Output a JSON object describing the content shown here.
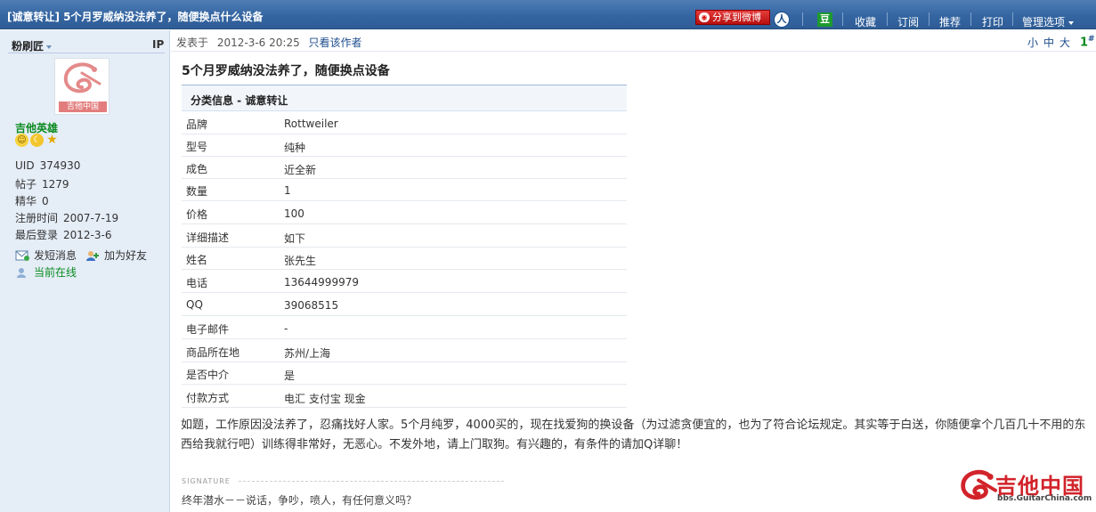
{
  "header": {
    "title": "[诚意转让] 5个月罗威纳没法养了，随便换点什么设备",
    "share_weibo": "分享到微博",
    "renren_glyph": "人",
    "douban_glyph": "豆",
    "actions": [
      "收藏",
      "订阅",
      "推荐",
      "打印"
    ],
    "manage": "管理选项"
  },
  "profile": {
    "username": "粉刷匠",
    "ip_label": "IP",
    "avatar_text": "吉他中国",
    "rank": "吉他英雄",
    "stats": [
      {
        "label": "UID",
        "value": "374930"
      },
      {
        "label": "帖子",
        "value": "1279"
      },
      {
        "label": "精华",
        "value": "0"
      },
      {
        "label": "注册时间",
        "value": "2007-7-19"
      },
      {
        "label": "最后登录",
        "value": "2012-3-6"
      }
    ],
    "send_message": "发短消息",
    "add_friend": "加为好友",
    "online": "当前在线"
  },
  "post": {
    "posted_label": "发表于",
    "posted_time": "2012-3-6 20:25",
    "only_author": "只看该作者",
    "font_small": "小",
    "font_medium": "中",
    "font_large": "大",
    "floor": "1",
    "floor_mark": "#",
    "title": "5个月罗威纳没法养了，随便换点设备",
    "info_header": "分类信息  - 诚意转让",
    "info_rows": [
      {
        "k": "品牌",
        "v": "Rottweiler"
      },
      {
        "k": "型号",
        "v": "纯种"
      },
      {
        "k": "成色",
        "v": "近全新"
      },
      {
        "k": "数量",
        "v": "1"
      },
      {
        "k": "价格",
        "v": "100"
      },
      {
        "k": "详细描述",
        "v": "如下"
      },
      {
        "k": "姓名",
        "v": "张先生"
      },
      {
        "k": "电话",
        "v": "13644999979"
      },
      {
        "k": "QQ",
        "v": "39068515"
      },
      {
        "k": "电子邮件",
        "v": "-"
      },
      {
        "k": "商品所在地",
        "v": "苏州/上海"
      },
      {
        "k": "是否中介",
        "v": "是"
      },
      {
        "k": "付款方式",
        "v": "电汇 支付宝 现金"
      }
    ],
    "body": "如题，工作原因没法养了，忍痛找好人家。5个月纯罗，4000买的，现在找爱狗的换设备（为过滤贪便宜的，也为了符合论坛规定。其实等于白送，你随便拿个几百几十不用的东西给我就行吧）训练得非常好，无恶心。不发外地，请上门取狗。有兴趣的，有条件的请加Q详聊！",
    "signature_label": "SIGNATURE",
    "signature": "终年潜水－－说话，争吵，喷人，有任何意义吗？"
  },
  "watermark": {
    "title": "吉他中国",
    "url": "bbs.GuitarChina.com"
  },
  "colors": {
    "header_blue": "#3566a2",
    "sidebar_bg": "#e5edf7",
    "rank_green": "#0a8a1f",
    "link_blue": "#1b4c8c",
    "brand_red": "#d2232a"
  }
}
